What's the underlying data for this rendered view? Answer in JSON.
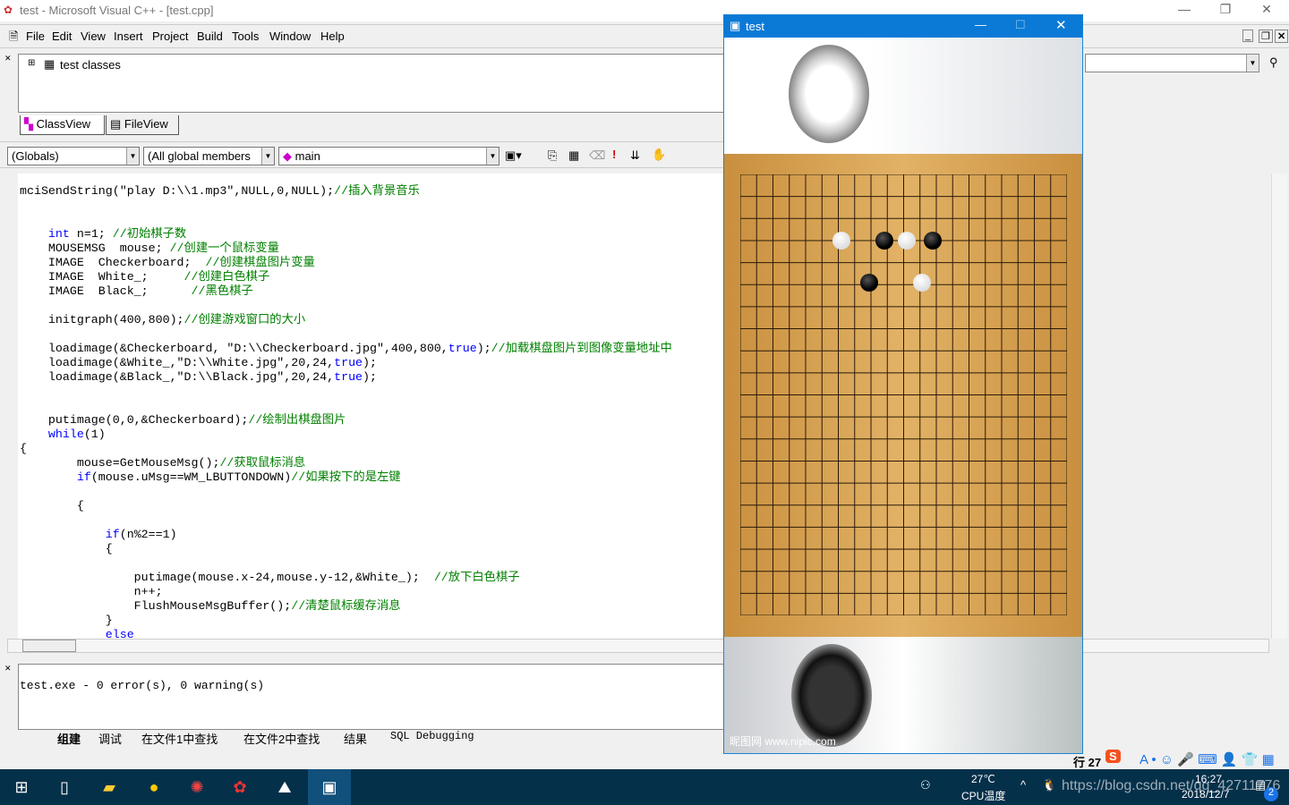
{
  "window": {
    "title": "test - Microsoft Visual C++ - [test.cpp]"
  },
  "menu": [
    "File",
    "Edit",
    "View",
    "Insert",
    "Project",
    "Build",
    "Tools",
    "Window",
    "Help"
  ],
  "workspace": {
    "tree_root": "test classes",
    "tabs": [
      "ClassView",
      "FileView"
    ]
  },
  "wizardbar": {
    "scope": "(Globals)",
    "filter": "(All global members",
    "function": "main"
  },
  "code": [
    [
      {
        "t": "mciSendString(\"play D:\\\\1.mp3\",NULL,0,NULL);",
        "c": "k"
      },
      {
        "t": "//插入背景音乐",
        "c": "g"
      }
    ],
    [],
    [],
    [
      {
        "t": "    ",
        "c": "k"
      },
      {
        "t": "int",
        "c": "b"
      },
      {
        "t": " n=1; ",
        "c": "k"
      },
      {
        "t": "//初始棋子数",
        "c": "g"
      }
    ],
    [
      {
        "t": "    MOUSEMSG  mouse; ",
        "c": "k"
      },
      {
        "t": "//创建一个鼠标变量",
        "c": "g"
      }
    ],
    [
      {
        "t": "    IMAGE  Checkerboard;  ",
        "c": "k"
      },
      {
        "t": "//创建棋盘图片变量",
        "c": "g"
      }
    ],
    [
      {
        "t": "    IMAGE  White_;     ",
        "c": "k"
      },
      {
        "t": "//创建白色棋子",
        "c": "g"
      }
    ],
    [
      {
        "t": "    IMAGE  Black_;      ",
        "c": "k"
      },
      {
        "t": "//黑色棋子",
        "c": "g"
      }
    ],
    [],
    [
      {
        "t": "    initgraph(400,800);",
        "c": "k"
      },
      {
        "t": "//创建游戏窗口的大小",
        "c": "g"
      }
    ],
    [],
    [
      {
        "t": "    loadimage(&Checkerboard, \"D:\\\\Checkerboard.jpg\",400,800,",
        "c": "k"
      },
      {
        "t": "true",
        "c": "b"
      },
      {
        "t": ");",
        "c": "k"
      },
      {
        "t": "//加载棋盘图片到图像变量地址中",
        "c": "g"
      }
    ],
    [
      {
        "t": "    loadimage(&White_,\"D:\\\\White.jpg\",20,24,",
        "c": "k"
      },
      {
        "t": "true",
        "c": "b"
      },
      {
        "t": ");",
        "c": "k"
      }
    ],
    [
      {
        "t": "    loadimage(&Black_,\"D:\\\\Black.jpg\",20,24,",
        "c": "k"
      },
      {
        "t": "true",
        "c": "b"
      },
      {
        "t": ");",
        "c": "k"
      }
    ],
    [],
    [],
    [
      {
        "t": "    putimage(0,0,&Checkerboard);",
        "c": "k"
      },
      {
        "t": "//绘制出棋盘图片",
        "c": "g"
      }
    ],
    [
      {
        "t": "    ",
        "c": "k"
      },
      {
        "t": "while",
        "c": "b"
      },
      {
        "t": "(1)",
        "c": "k"
      }
    ],
    [
      {
        "t": "{",
        "c": "k"
      }
    ],
    [
      {
        "t": "        mouse=GetMouseMsg();",
        "c": "k"
      },
      {
        "t": "//获取鼠标消息",
        "c": "g"
      }
    ],
    [
      {
        "t": "        ",
        "c": "k"
      },
      {
        "t": "if",
        "c": "b"
      },
      {
        "t": "(mouse.uMsg==WM_LBUTTONDOWN)",
        "c": "k"
      },
      {
        "t": "//如果按下的是左键",
        "c": "g"
      }
    ],
    [],
    [
      {
        "t": "        {",
        "c": "k"
      }
    ],
    [],
    [
      {
        "t": "            ",
        "c": "k"
      },
      {
        "t": "if",
        "c": "b"
      },
      {
        "t": "(n%2==1)",
        "c": "k"
      }
    ],
    [
      {
        "t": "            {",
        "c": "k"
      }
    ],
    [],
    [
      {
        "t": "                putimage(mouse.x-24,mouse.y-12,&White_);  ",
        "c": "k"
      },
      {
        "t": "//放下白色棋子",
        "c": "g"
      }
    ],
    [
      {
        "t": "                n++;",
        "c": "k"
      }
    ],
    [
      {
        "t": "                FlushMouseMsgBuffer();",
        "c": "k"
      },
      {
        "t": "//清楚鼠标缓存消息",
        "c": "g"
      }
    ],
    [
      {
        "t": "            }",
        "c": "k"
      }
    ],
    [
      {
        "t": "            ",
        "c": "k"
      },
      {
        "t": "else",
        "c": "b"
      }
    ]
  ],
  "output": {
    "text": "test.exe - 0 error(s), 0 warning(s)",
    "tabs": [
      "组建",
      "调试",
      "在文件1中查找",
      "在文件2中查找",
      "结果",
      "SQL Debugging"
    ]
  },
  "status": {
    "row_label": "行 27"
  },
  "game": {
    "title": "test",
    "watermark": "昵图网 www.nipic.com",
    "stones": [
      {
        "color": "white",
        "col": 6.2,
        "row": 3.0
      },
      {
        "color": "black",
        "col": 8.8,
        "row": 3.0
      },
      {
        "color": "white",
        "col": 10.2,
        "row": 3.0
      },
      {
        "color": "black",
        "col": 11.8,
        "row": 3.0
      },
      {
        "color": "black",
        "col": 7.9,
        "row": 4.9
      },
      {
        "color": "white",
        "col": 11.1,
        "row": 4.9
      }
    ]
  },
  "taskbar": {
    "temp": "27℃",
    "temp_label": "CPU温度",
    "time": "16:27",
    "date": "2018/12/7",
    "notifications": "2",
    "url_watermark": "https://blog.csdn.net/qq_42711776"
  }
}
